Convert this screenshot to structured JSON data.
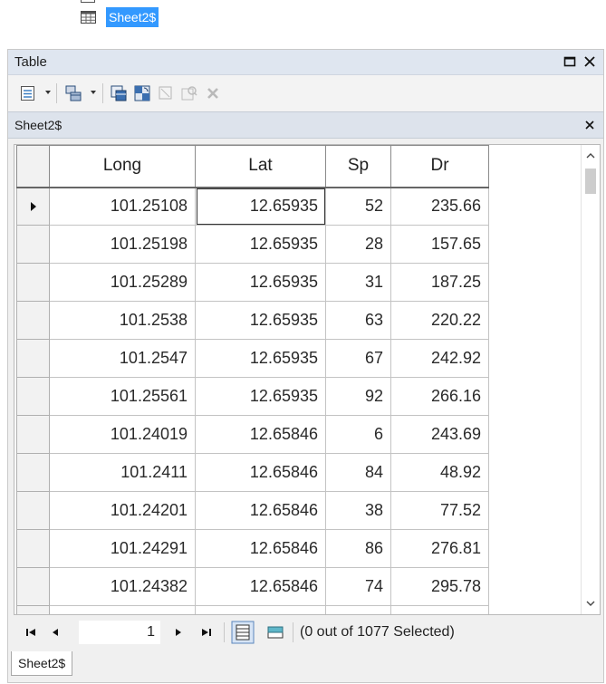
{
  "tree": {
    "layer_label": "Sheet2$",
    "layer_icon": "table-icon"
  },
  "window": {
    "title": "Table",
    "restore_icon": "restore-icon",
    "close_icon": "close-icon"
  },
  "toolbar": {
    "items": [
      "table-options-icon",
      "related-tables-icon",
      "select-by-attributes-icon",
      "switch-selection-icon",
      "clear-selection-icon",
      "zoom-to-selected-icon",
      "delete-selected-icon"
    ]
  },
  "tab": {
    "label": "Sheet2$",
    "close_icon": "close-icon"
  },
  "table": {
    "columns": [
      "Long",
      "Lat",
      "Sp",
      "Dr"
    ],
    "rows": [
      [
        "101.25108",
        "12.65935",
        "52",
        "235.66"
      ],
      [
        "101.25198",
        "12.65935",
        "28",
        "157.65"
      ],
      [
        "101.25289",
        "12.65935",
        "31",
        "187.25"
      ],
      [
        "101.2538",
        "12.65935",
        "63",
        "220.22"
      ],
      [
        "101.2547",
        "12.65935",
        "67",
        "242.92"
      ],
      [
        "101.25561",
        "12.65935",
        "92",
        "266.16"
      ],
      [
        "101.24019",
        "12.65846",
        "6",
        "243.69"
      ],
      [
        "101.2411",
        "12.65846",
        "84",
        "48.92"
      ],
      [
        "101.24201",
        "12.65846",
        "38",
        "77.52"
      ],
      [
        "101.24291",
        "12.65846",
        "86",
        "276.81"
      ],
      [
        "101.24382",
        "12.65846",
        "74",
        "295.78"
      ]
    ],
    "current_row": 0,
    "current_column": 1
  },
  "navigation": {
    "page_value": "1",
    "status": "(0 out of 1077 Selected)",
    "first_icon": "first-record-icon",
    "prev_icon": "previous-record-icon",
    "next_icon": "next-record-icon",
    "last_icon": "last-record-icon",
    "show_all_icon": "show-all-records-icon",
    "show_selected_icon": "show-selected-records-icon"
  },
  "bottom_tab": {
    "label": "Sheet2$"
  },
  "colors": {
    "highlight": "#3399ff",
    "title_bar": "#dfe6f0",
    "tab_bar": "#dde3ec"
  }
}
